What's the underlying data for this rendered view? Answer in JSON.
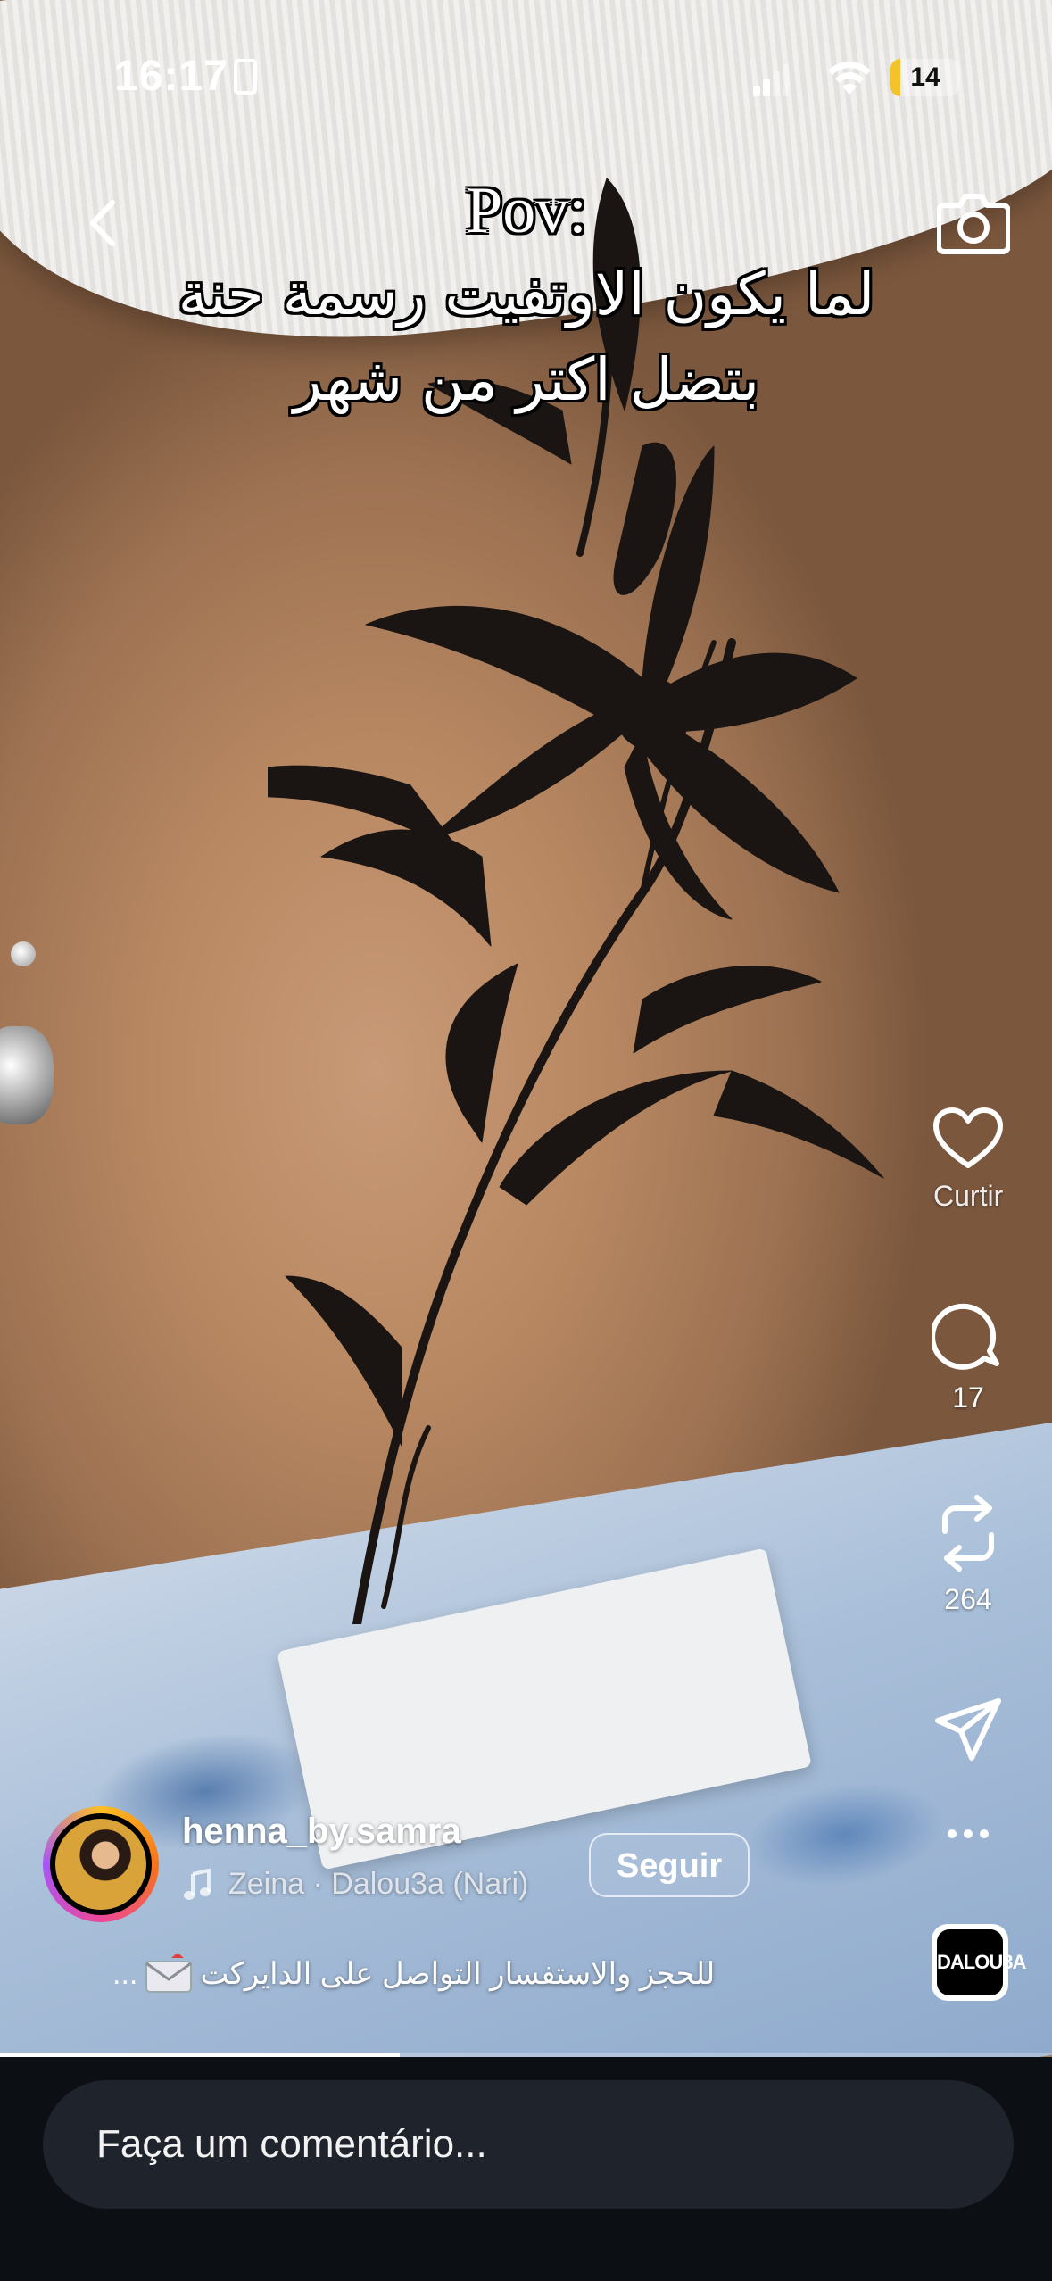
{
  "status_bar": {
    "time": "16:17",
    "battery_level": "14",
    "battery_fraction": 0.14,
    "battery_color": "#f2c32b"
  },
  "reel": {
    "caption_title": "Pov:",
    "caption_line1": "لما يكون الاوتفيت رسمة حنة",
    "caption_line2": "بتضل اكتر من شهر",
    "actions": {
      "like_label": "Curtir",
      "comments_count": "17",
      "reposts_count": "264"
    },
    "author": {
      "username": "henna_by.samra",
      "audio": "Zeina · Dalou3a (Nari)",
      "follow_label": "Seguir",
      "description": "للحجز والاستفسار التواصل على الدايركت",
      "description_more": "...",
      "audio_thumb_label": "DALOU3A"
    },
    "progress": 0.38
  },
  "comment_box": {
    "placeholder": "Faça um comentário..."
  },
  "icons": {
    "back": "chevron-left-icon",
    "camera": "camera-icon",
    "like": "heart-icon",
    "comment": "comment-bubble-icon",
    "repost": "repost-icon",
    "share": "paper-plane-icon",
    "more": "more-dots-icon",
    "music": "music-note-icon",
    "envelope": "envelope-icon"
  }
}
